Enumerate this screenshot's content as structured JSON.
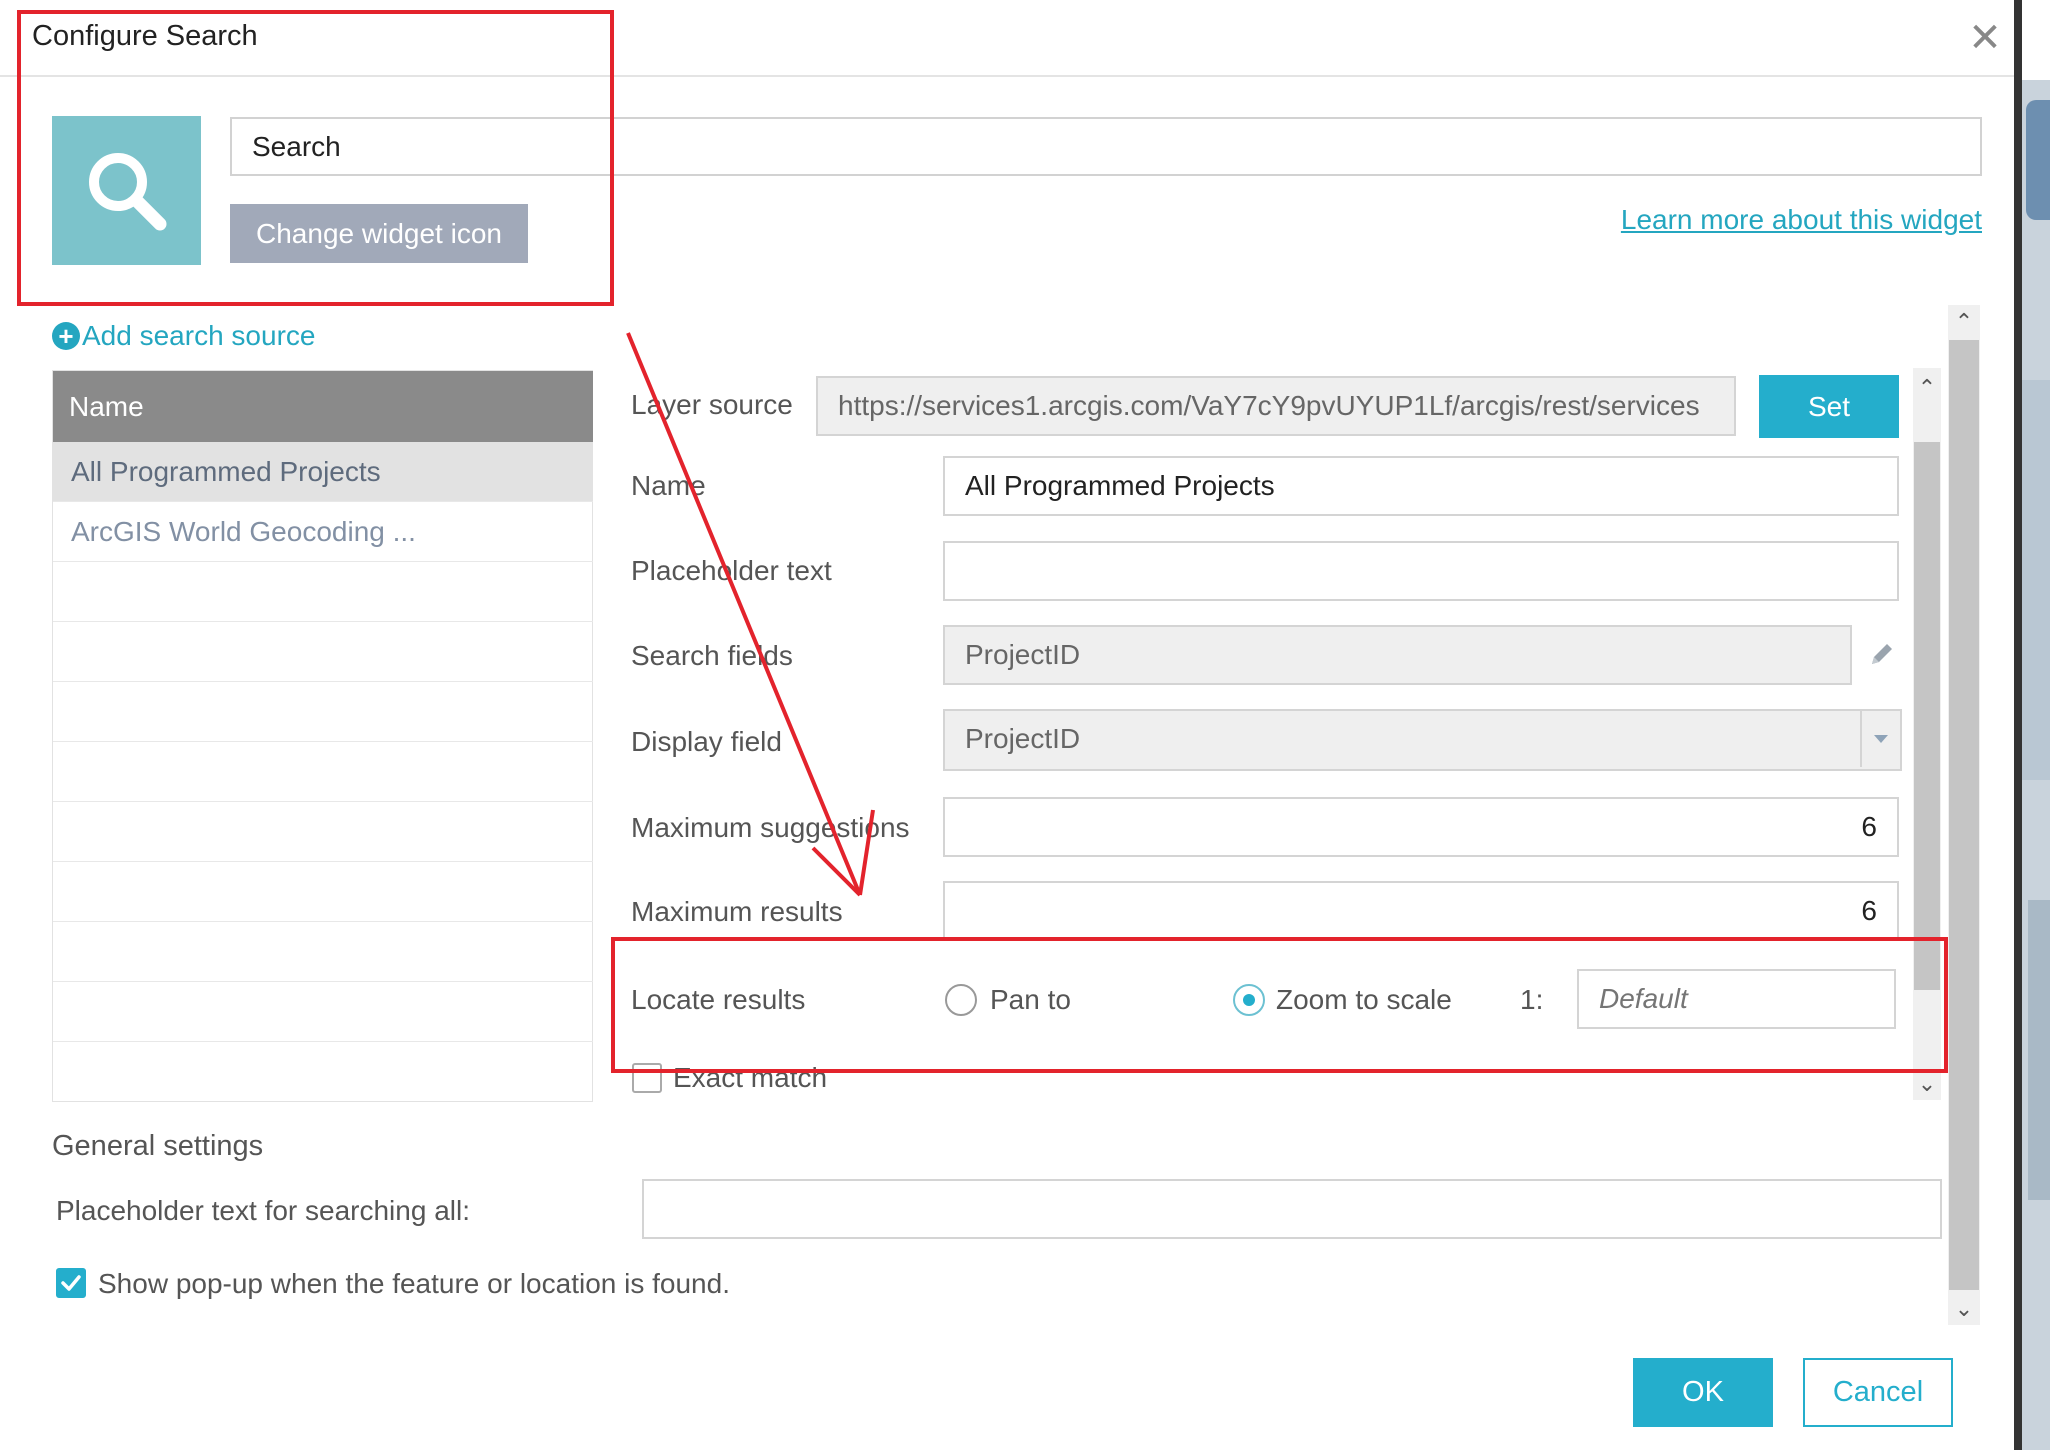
{
  "dialog": {
    "title": "Configure Search",
    "close_icon": "close-icon",
    "widget_label": "Search",
    "change_icon_label": "Change widget icon",
    "learn_more_label": "Learn more about this widget"
  },
  "sources": {
    "add_label": "Add search source",
    "header": "Name",
    "rows": [
      "All Programmed Projects",
      "ArcGIS World Geocoding ..."
    ]
  },
  "form": {
    "layer_source_label": "Layer source",
    "layer_source_value": "https://services1.arcgis.com/VaY7cY9pvUYUP1Lf/arcgis/rest/services",
    "set_label": "Set",
    "name_label": "Name",
    "name_value": "All Programmed Projects",
    "placeholder_label": "Placeholder text",
    "placeholder_value": "",
    "search_fields_label": "Search fields",
    "search_fields_value": "ProjectID",
    "display_field_label": "Display field",
    "display_field_value": "ProjectID",
    "max_suggestions_label": "Maximum suggestions",
    "max_suggestions_value": "6",
    "max_results_label": "Maximum results",
    "max_results_value": "6",
    "locate_label": "Locate results",
    "pan_label": "Pan to",
    "zoom_label": "Zoom to scale",
    "scale_prefix": "1:",
    "scale_placeholder": "Default",
    "exact_match_label": "Exact match"
  },
  "general": {
    "heading": "General settings",
    "placeholder_all_label": "Placeholder text for searching all:",
    "placeholder_all_value": "",
    "show_popup_label": "Show pop-up when the feature or location is found."
  },
  "footer": {
    "ok_label": "OK",
    "cancel_label": "Cancel"
  },
  "colors": {
    "accent": "#24aecc",
    "annotation": "#e3232c",
    "icon_tile": "#7cc3cb"
  }
}
